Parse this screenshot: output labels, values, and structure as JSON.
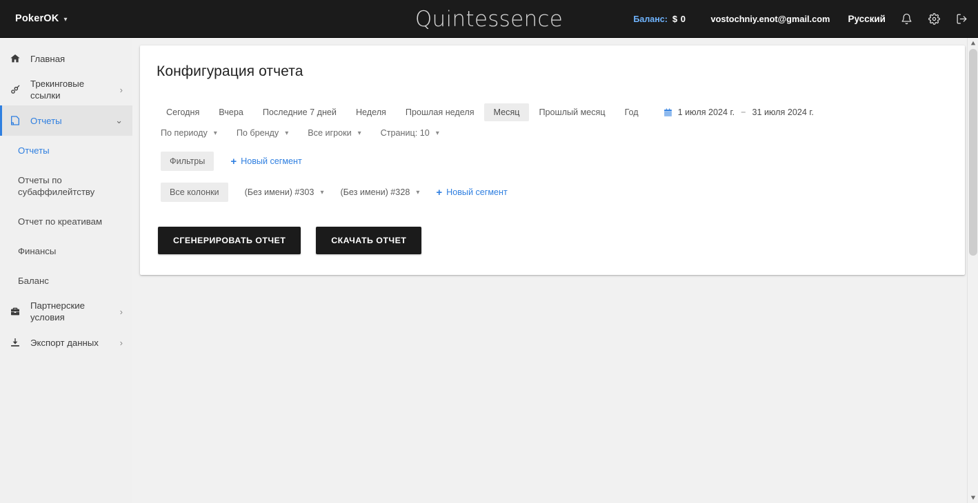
{
  "topbar": {
    "brand": "PokerOK",
    "brand_caret": "chevron-down-icon",
    "logo": "Quintessence",
    "balance_label": "Баланс:",
    "balance_value": "$ 0",
    "email": "vostochniy.enot@gmail.com",
    "language": "Русский",
    "icons": [
      "bell-icon",
      "gear-icon",
      "logout-icon"
    ]
  },
  "sidebar": {
    "items": [
      {
        "label": "Главная",
        "icon": "home-icon",
        "expandable": false,
        "active": false
      },
      {
        "label": "Трекинговые ссылки",
        "icon": "link-icon",
        "expandable": true,
        "active": false
      },
      {
        "label": "Отчеты",
        "icon": "report-page-icon",
        "expandable": true,
        "active": true
      },
      {
        "label": "Партнерские условия",
        "icon": "briefcase-icon",
        "expandable": true,
        "active": false
      },
      {
        "label": "Экспорт данных",
        "icon": "download-icon",
        "expandable": true,
        "active": false
      }
    ],
    "sub_items": [
      {
        "label": "Отчеты",
        "current": true
      },
      {
        "label": "Отчеты по субаффилейтству",
        "current": false
      },
      {
        "label": "Отчет по креативам",
        "current": false
      },
      {
        "label": "Финансы",
        "current": false
      },
      {
        "label": "Баланс",
        "current": false
      }
    ]
  },
  "main": {
    "title": "Конфигурация отчета",
    "period_tabs": [
      {
        "label": "Сегодня",
        "selected": false
      },
      {
        "label": "Вчера",
        "selected": false
      },
      {
        "label": "Последние 7 дней",
        "selected": false
      },
      {
        "label": "Неделя",
        "selected": false
      },
      {
        "label": "Прошлая неделя",
        "selected": false
      },
      {
        "label": "Месяц",
        "selected": true
      },
      {
        "label": "Прошлый месяц",
        "selected": false
      },
      {
        "label": "Год",
        "selected": false
      }
    ],
    "date_range": {
      "icon": "calendar-icon",
      "start": "1 июля 2024 г.",
      "separator": "−",
      "end": "31 июля 2024 г."
    },
    "dropdowns": [
      {
        "label": "По периоду"
      },
      {
        "label": "По бренду"
      },
      {
        "label": "Все игроки"
      },
      {
        "label": "Страниц: 10"
      }
    ],
    "filters_row": {
      "chip": "Фильтры",
      "new_segment": "Новый сегмент"
    },
    "columns_row": {
      "chip": "Все колонки",
      "segments": [
        {
          "label": "(Без имени) #303"
        },
        {
          "label": "(Без имени) #328"
        }
      ],
      "new_segment": "Новый сегмент"
    },
    "buttons": [
      {
        "label": "СГЕНЕРИРОВАТЬ ОТЧЕТ"
      },
      {
        "label": "СКАЧАТЬ ОТЧЕТ"
      }
    ]
  },
  "colors": {
    "topbar_bg": "#1b1b1b",
    "accent_blue": "#2f7fe0",
    "balance_blue": "#6fb4ff",
    "page_bg": "#f1f1f1",
    "sidebar_bg": "#f0f0f0",
    "chip_bg": "#ececec",
    "button_bg": "#1b1b1b"
  }
}
